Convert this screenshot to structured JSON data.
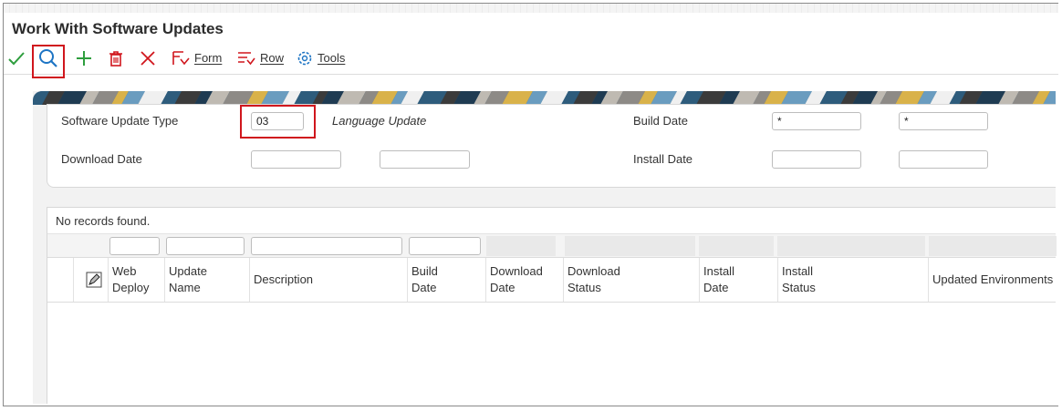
{
  "window": {
    "title": "Work With Software Updates"
  },
  "toolbar": {
    "select_icon": "checkmark-icon",
    "find_icon": "search-icon",
    "add_icon": "plus-icon",
    "delete_icon": "trash-icon",
    "close_icon": "close-icon",
    "form_label": "Form",
    "row_label": "Row",
    "tools_label": "Tools"
  },
  "colors": {
    "accent_blue": "#1d74c4",
    "green": "#2e9e3e",
    "red": "#d0161d",
    "highlight": "#d0161d"
  },
  "filters": {
    "software_update_type_label": "Software Update Type",
    "software_update_type_value": "03",
    "software_update_type_desc": "Language Update",
    "build_date_label": "Build Date",
    "build_date_from": "*",
    "build_date_to": "*",
    "download_date_label": "Download Date",
    "download_date_from": "",
    "download_date_to": "",
    "install_date_label": "Install Date",
    "install_date_from": "",
    "install_date_to": ""
  },
  "grid": {
    "status": "No records found.",
    "columns": [
      {
        "line1": "Web",
        "line2": "Deploy"
      },
      {
        "line1": "Update",
        "line2": "Name"
      },
      {
        "line1": "Description",
        "line2": ""
      },
      {
        "line1": "Build",
        "line2": "Date"
      },
      {
        "line1": "Download",
        "line2": "Date"
      },
      {
        "line1": "Download",
        "line2": "Status"
      },
      {
        "line1": "Install",
        "line2": "Date"
      },
      {
        "line1": "Install",
        "line2": "Status"
      },
      {
        "line1": "Updated Environments",
        "line2": ""
      }
    ],
    "rows": []
  }
}
